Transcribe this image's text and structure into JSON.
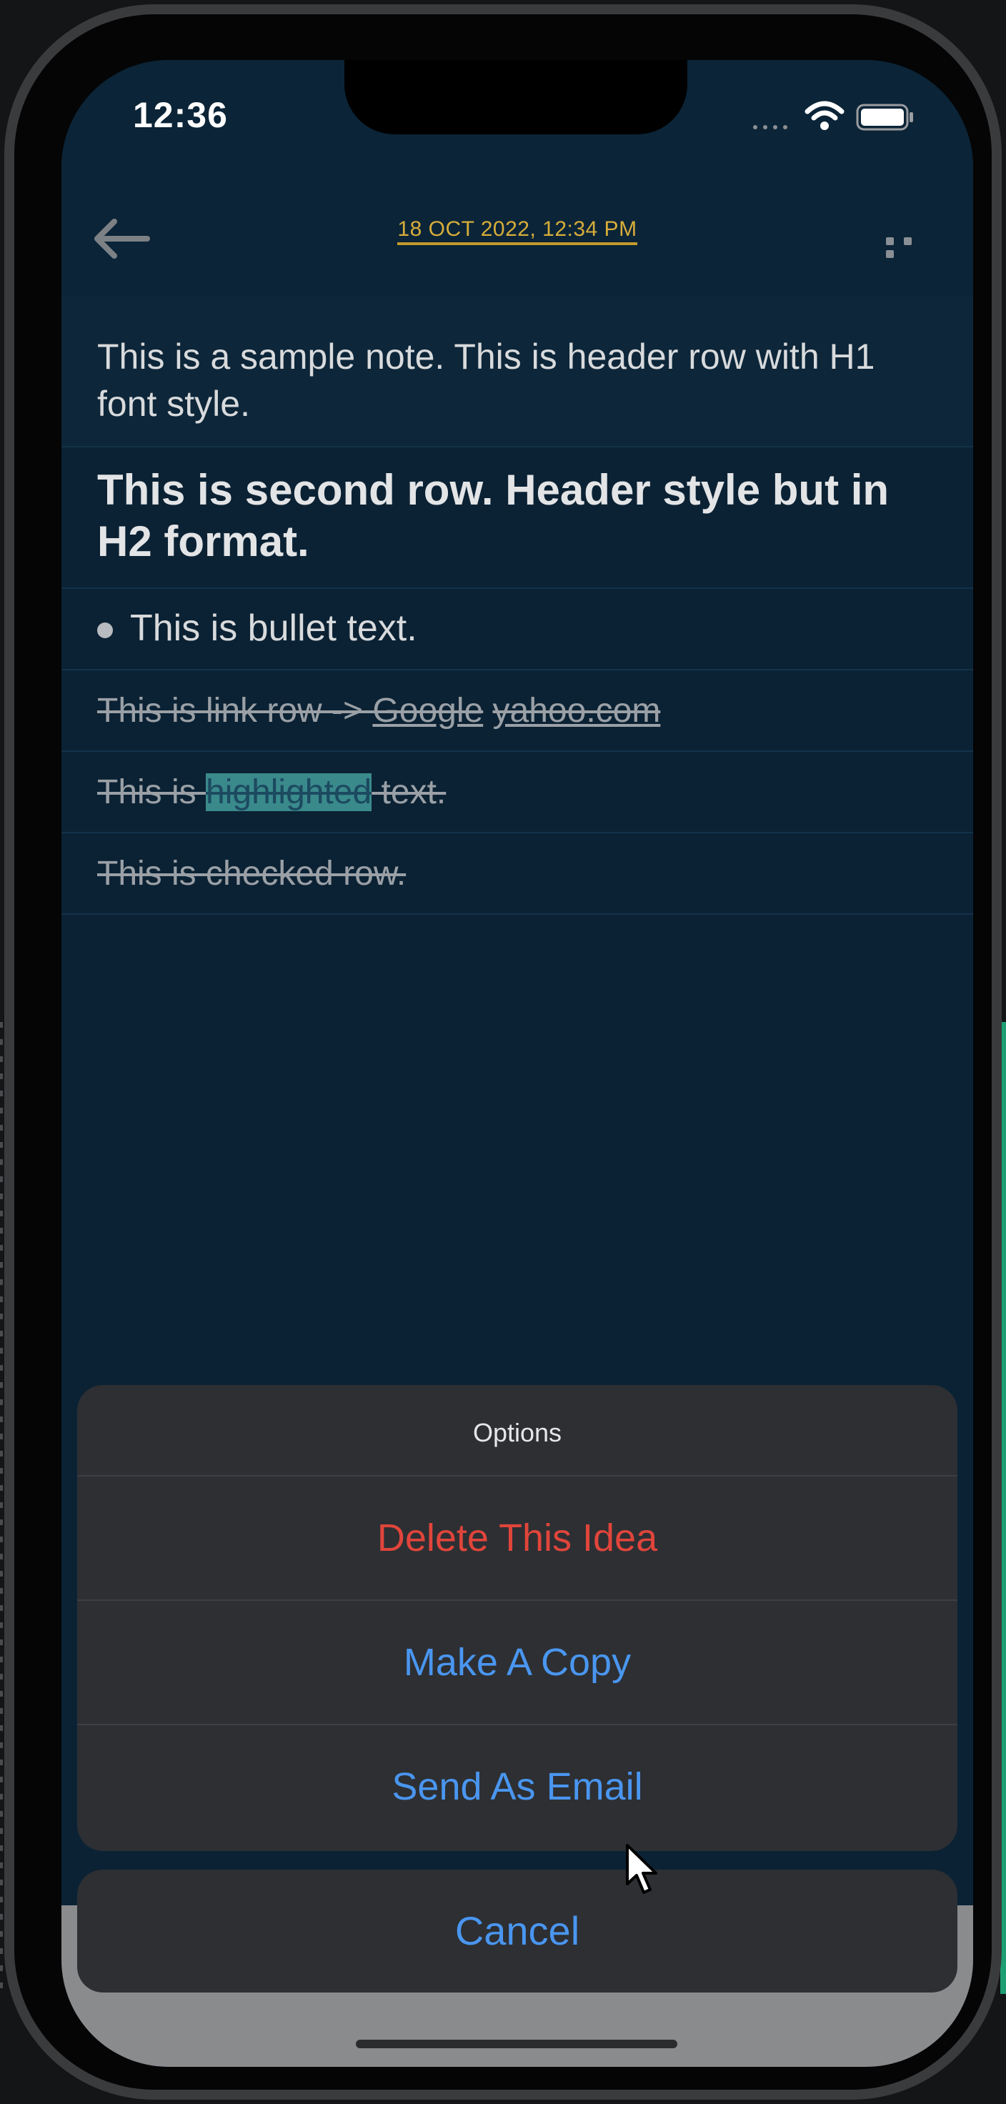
{
  "status_bar": {
    "time": "12:36"
  },
  "header": {
    "title": "18 OCT 2022, 12:34 PM",
    "back_icon": "arrow-left-icon",
    "more_icon": "more-dots-icon",
    "title_color": "#d7ad3a"
  },
  "note": {
    "rows": [
      {
        "type": "h1",
        "text": "This is a sample note. This is header row with H1 font style."
      },
      {
        "type": "h2",
        "text": "This is second row. Header style but in H2 format."
      },
      {
        "type": "bullet",
        "text": "This is bullet text."
      },
      {
        "type": "link",
        "prefix": "This is link row -> ",
        "link1": "Google",
        "link2": "yahoo.com"
      },
      {
        "type": "highlight",
        "before": "This is ",
        "highlighted": "highlighted",
        "after": " text."
      },
      {
        "type": "checked",
        "text": "This is checked row."
      }
    ]
  },
  "action_sheet": {
    "title": "Options",
    "items": [
      {
        "label": "Delete This Idea",
        "style": "destructive",
        "color": "#e0453b"
      },
      {
        "label": "Make A Copy",
        "style": "default",
        "color": "#4a96f0"
      },
      {
        "label": "Send As Email",
        "style": "default",
        "color": "#4a96f0"
      }
    ],
    "cancel_label": "Cancel"
  }
}
